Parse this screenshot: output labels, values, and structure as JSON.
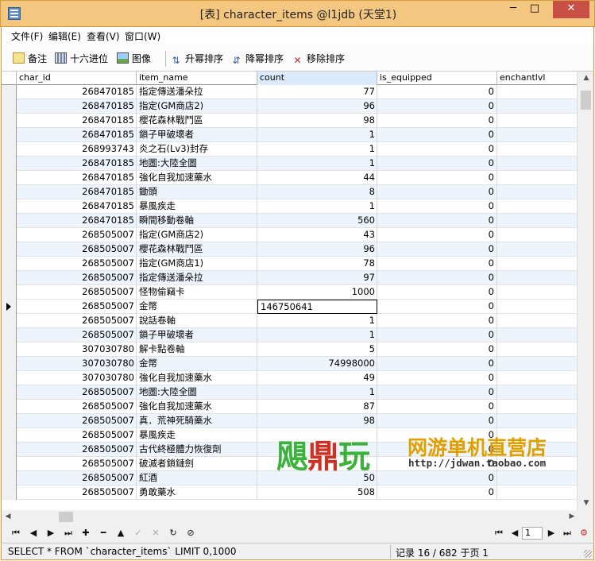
{
  "window": {
    "title": "[表] character_items @l1jdb (天堂1)",
    "minimize_glyph": "─",
    "maximize_glyph": "□",
    "close_glyph": "✕"
  },
  "menu": [
    "文件(F)",
    "编辑(E)",
    "查看(V)",
    "窗口(W)"
  ],
  "toolbar": {
    "memo": "备注",
    "hex": "十六进位",
    "image": "图像",
    "sort_asc": "升幂排序",
    "sort_desc": "降幂排序",
    "remove_sort": "移除排序"
  },
  "columns": [
    "char_id",
    "item_name",
    "count",
    "is_equipped",
    "enchantlvl"
  ],
  "rows": [
    {
      "char_id": "268470185",
      "item_name": "指定傳送潘朵拉",
      "count": "77",
      "is_equipped": "0"
    },
    {
      "char_id": "268470185",
      "item_name": "指定(GM商店2)",
      "count": "96",
      "is_equipped": "0"
    },
    {
      "char_id": "268470185",
      "item_name": "櫻花森林戰鬥區",
      "count": "98",
      "is_equipped": "0"
    },
    {
      "char_id": "268470185",
      "item_name": "鎖子甲破壞者",
      "count": "1",
      "is_equipped": "0"
    },
    {
      "char_id": "268993743",
      "item_name": "炎之石(Lv3)封存",
      "count": "1",
      "is_equipped": "0"
    },
    {
      "char_id": "268470185",
      "item_name": "地圖:大陸全圖",
      "count": "1",
      "is_equipped": "0"
    },
    {
      "char_id": "268470185",
      "item_name": "強化自我加速藥水",
      "count": "44",
      "is_equipped": "0"
    },
    {
      "char_id": "268470185",
      "item_name": "鋤頭",
      "count": "8",
      "is_equipped": "0"
    },
    {
      "char_id": "268470185",
      "item_name": "暴風疾走",
      "count": "1",
      "is_equipped": "0"
    },
    {
      "char_id": "268470185",
      "item_name": "瞬間移動卷軸",
      "count": "560",
      "is_equipped": "0"
    },
    {
      "char_id": "268505007",
      "item_name": "指定(GM商店2)",
      "count": "43",
      "is_equipped": "0"
    },
    {
      "char_id": "268505007",
      "item_name": "櫻花森林戰鬥區",
      "count": "96",
      "is_equipped": "0"
    },
    {
      "char_id": "268505007",
      "item_name": "指定(GM商店1)",
      "count": "78",
      "is_equipped": "0"
    },
    {
      "char_id": "268505007",
      "item_name": "指定傳送潘朵拉",
      "count": "97",
      "is_equipped": "0"
    },
    {
      "char_id": "268505007",
      "item_name": "怪物偷竊卡",
      "count": "1000",
      "is_equipped": "0"
    },
    {
      "char_id": "268505007",
      "item_name": "金幣",
      "count": "146750641",
      "is_equipped": "0"
    },
    {
      "char_id": "268505007",
      "item_name": "說話卷軸",
      "count": "1",
      "is_equipped": "0"
    },
    {
      "char_id": "268505007",
      "item_name": "鎖子甲破壞者",
      "count": "1",
      "is_equipped": "0"
    },
    {
      "char_id": "307030780",
      "item_name": "解卡點卷軸",
      "count": "5",
      "is_equipped": "0"
    },
    {
      "char_id": "307030780",
      "item_name": "金幣",
      "count": "74998000",
      "is_equipped": "0"
    },
    {
      "char_id": "307030780",
      "item_name": "強化自我加速藥水",
      "count": "49",
      "is_equipped": "0"
    },
    {
      "char_id": "268505007",
      "item_name": "地圖:大陸全圖",
      "count": "1",
      "is_equipped": "0"
    },
    {
      "char_id": "268505007",
      "item_name": "強化自我加速藥水",
      "count": "87",
      "is_equipped": "0"
    },
    {
      "char_id": "268505007",
      "item_name": "真．荒神死騎藥水",
      "count": "98",
      "is_equipped": "0"
    },
    {
      "char_id": "268505007",
      "item_name": "暴風疾走",
      "count": "",
      "is_equipped": "0"
    },
    {
      "char_id": "268505007",
      "item_name": "古代終極體力恢復劑",
      "count": "",
      "is_equipped": "0"
    },
    {
      "char_id": "268505007",
      "item_name": "破滅者鎖鏈劍",
      "count": "",
      "is_equipped": "0"
    },
    {
      "char_id": "268505007",
      "item_name": "紅酒",
      "count": "50",
      "is_equipped": "0"
    },
    {
      "char_id": "268505007",
      "item_name": "勇敢藥水",
      "count": "508",
      "is_equipped": "0"
    }
  ],
  "current_row_index": 15,
  "selected_column": "count",
  "watermark": {
    "brand_green": "飓",
    "brand_red": "鼎",
    "brand_green2": "玩",
    "tagline": "网游单机直营店",
    "url": "http://jdwan.taobao.com"
  },
  "navigation": {
    "page_value": "1"
  },
  "status": {
    "sql": "SELECT * FROM `character_items` LIMIT 0,1000",
    "record": "记录 16 / 682 于页 1"
  },
  "colors": {
    "titlebar": "#f3c77f",
    "alt_row": "#edf4fc",
    "close_button": "#c74f44"
  }
}
